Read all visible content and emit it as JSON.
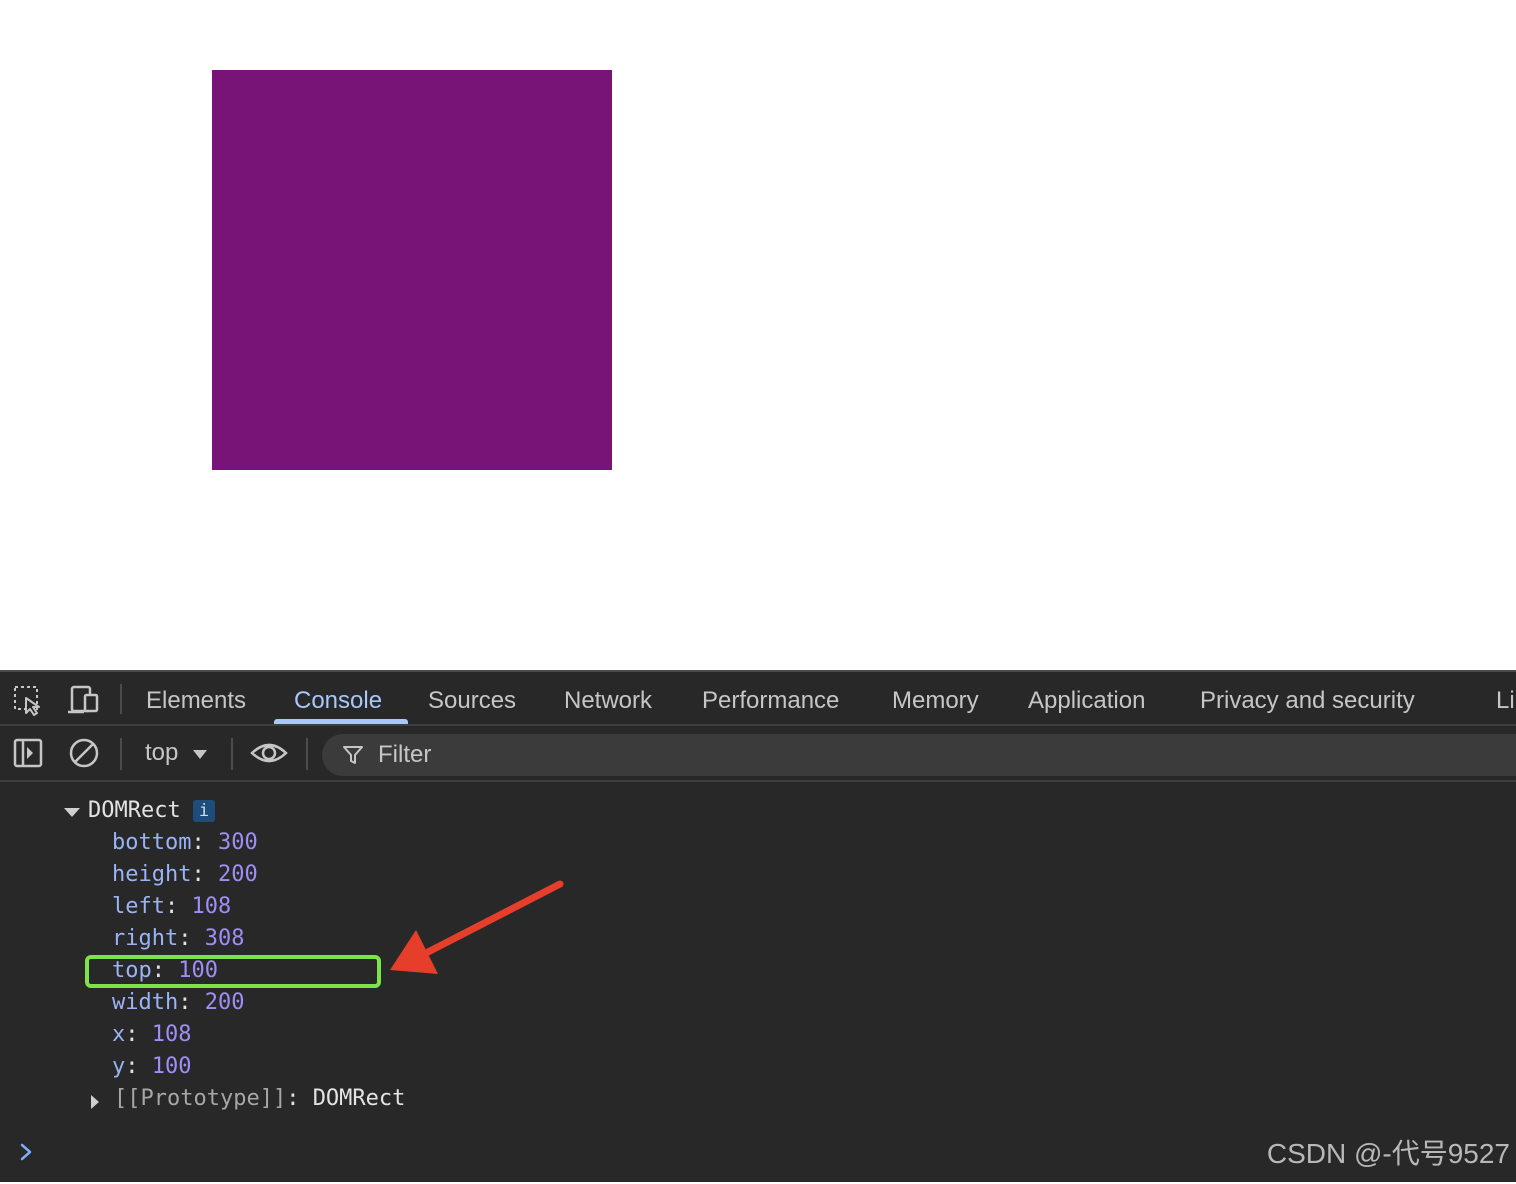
{
  "page": {
    "box_color": "#781478"
  },
  "devtools": {
    "tabs": [
      {
        "label": "Elements",
        "active": false
      },
      {
        "label": "Console",
        "active": true
      },
      {
        "label": "Sources",
        "active": false
      },
      {
        "label": "Network",
        "active": false
      },
      {
        "label": "Performance",
        "active": false
      },
      {
        "label": "Memory",
        "active": false
      },
      {
        "label": "Application",
        "active": false
      },
      {
        "label": "Privacy and security",
        "active": false
      },
      {
        "label": "Li",
        "active": false
      }
    ],
    "icons": {
      "inspect": "inspect-element-icon",
      "device": "device-toolbar-icon",
      "sidebar": "sidebar-toggle-icon",
      "clear": "clear-console-icon",
      "eye": "live-expression-icon",
      "filter": "filter-icon"
    },
    "toolbar": {
      "context": "top",
      "filter_placeholder": "Filter"
    },
    "console": {
      "object_name": "DOMRect",
      "info_badge": "i",
      "properties": [
        {
          "key": "bottom",
          "value": "300"
        },
        {
          "key": "height",
          "value": "200"
        },
        {
          "key": "left",
          "value": "108"
        },
        {
          "key": "right",
          "value": "308"
        },
        {
          "key": "top",
          "value": "100"
        },
        {
          "key": "width",
          "value": "200"
        },
        {
          "key": "x",
          "value": "108"
        },
        {
          "key": "y",
          "value": "100"
        }
      ],
      "prototype_key": "[[Prototype]]",
      "prototype_value": "DOMRect",
      "colon": ":"
    }
  },
  "annotation": {
    "highlight_color": "#7ee24a",
    "arrow_color": "#e53e2a"
  },
  "watermark": "CSDN @-代号9527"
}
